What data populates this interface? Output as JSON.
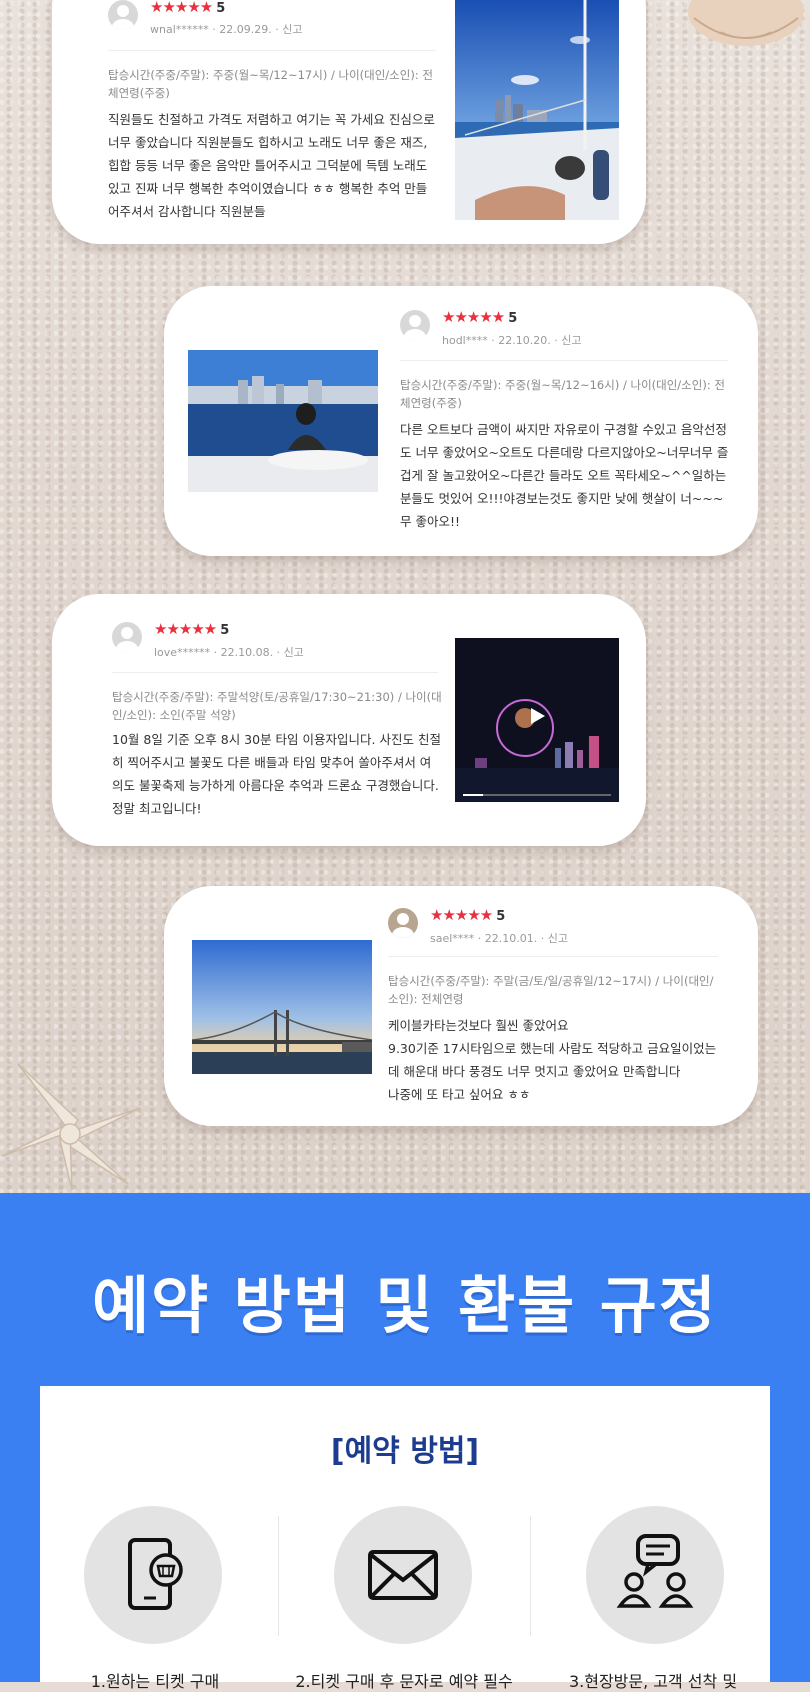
{
  "reviews": [
    {
      "user": "wnal******",
      "date": "22.09.29.",
      "report": "신고",
      "stars": "★★★★★",
      "score": "5",
      "info": "탑승시간(주중/주말): 주중(월~목/12~17시) / 나이(대인/소인): 전체연령(주중)",
      "text": "직원들도 친절하고 가격도 저렴하고 여기는 꼭 가세요 진심으로 너무 좋았습니다 직원분들도 힙하시고 노래도 너무 좋은 재즈,힙합 등등 너무 좋은 음악만 틀어주시고 그덕분에 득템 노래도 있고 진짜 너무 행복한 추억이였습니다 ㅎㅎ 행복한 추억 만들어주셔서 감사합니다 직원분들",
      "photo": "yacht deck with city skyline"
    },
    {
      "user": "hodl****",
      "date": "22.10.20.",
      "report": "신고",
      "stars": "★★★★★",
      "score": "5",
      "info": "탑승시간(주중/주말): 주중(월~목/12~16시) / 나이(대인/소인): 전체연령(주중)",
      "text": "다른 오트보다 금액이 싸지만 자유로이 구경할 수있고 음악선정도 너무 좋았어오~오트도 다른데랑 다르지않아오~너무너무 즐겁게 잘 놀고왔어오~다른간 들라도 오트 꼭타세오~^^일하는 분들도 멋있어 오!!!야경보는것도 좋지만 낮에 햇살이 너~~~무 좋아오!!",
      "photo": "person on yacht with skyline"
    },
    {
      "user": "love******",
      "date": "22.10.08.",
      "report": "신고",
      "stars": "★★★★★",
      "score": "5",
      "info": "탑승시간(주중/주말): 주말석양(토/공휴일/17:30~21:30) / 나이(대인/소인): 소인(주말 석양)",
      "text": "10월 8일 기준 오후 8시 30분 타임 이용자입니다. 사진도 친절히 찍어주시고 불꽃도 다른 배들과 타임 맞추어 쏠아주셔서 여의도 불꽃축제 능가하게 아름다운 추억과 드론쇼 구경했습니다. 정말 최고입니다!",
      "photo": "night drone show video"
    },
    {
      "user": "sael****",
      "date": "22.10.01.",
      "report": "신고",
      "stars": "★★★★★",
      "score": "5",
      "info": "탑승시간(주중/주말): 주말(금/토/일/공휴일/12~17시) / 나이(대인/소인): 전체연령",
      "text": "케이블카타는것보다 훨씬 좋았어요\n9.30기준 17시타임으로 했는데 사람도 적당하고 금요일이었는데 해운대 바다 풍경도 너무 멋지고 좋았어요 만족합니다\n나중에 또 타고 싶어요 ㅎㅎ",
      "photo": "Gwangan bridge at sunset"
    }
  ],
  "section": {
    "title": "예약 방법 및 환불 규정",
    "panel_title": "[예약 방법]",
    "steps": [
      {
        "label": "1.원하는 티켓 구매",
        "icon": "mobile-shop-icon"
      },
      {
        "label": "2.티켓 구매 후 문자로 예약 필수",
        "icon": "envelope-icon"
      },
      {
        "label": "3.현장방문, 고객 선착 및",
        "icon": "chat-people-icon"
      }
    ]
  },
  "colors": {
    "star": "#e8303f",
    "blue": "#3b80f3",
    "panel_title": "#1d3c8f"
  }
}
